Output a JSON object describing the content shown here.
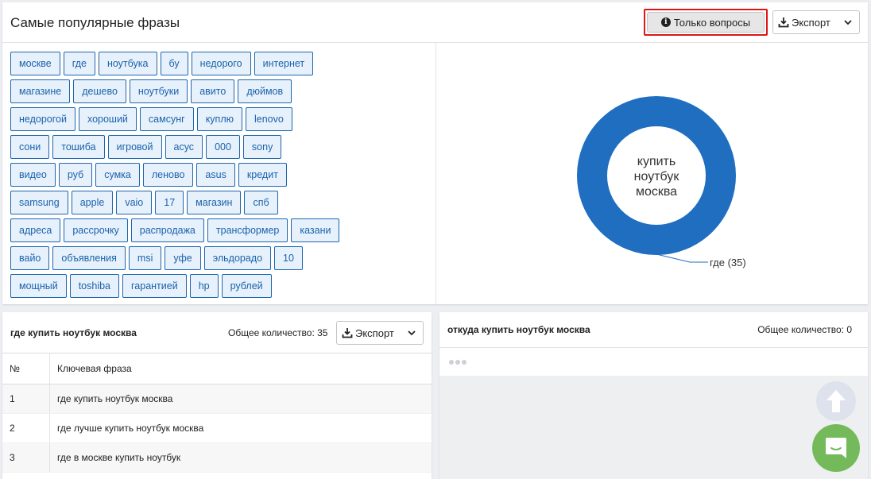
{
  "top": {
    "title": "Самые популярные фразы",
    "only_questions_label": "Только вопросы",
    "export_label": "Экспорт"
  },
  "tags": [
    [
      "москве",
      "где",
      "ноутбука",
      "бу",
      "недорого",
      "интернет"
    ],
    [
      "магазине",
      "дешево",
      "ноутбуки",
      "авито",
      "дюймов"
    ],
    [
      "недорогой",
      "хороший",
      "самсунг",
      "куплю",
      "lenovo"
    ],
    [
      "сони",
      "тошиба",
      "игровой",
      "асус",
      "000",
      "sony"
    ],
    [
      "видео",
      "руб",
      "сумка",
      "леново",
      "asus",
      "кредит"
    ],
    [
      "samsung",
      "apple",
      "vaio",
      "17",
      "магазин",
      "спб"
    ],
    [
      "адреса",
      "рассрочку",
      "распродажа",
      "трансформер",
      "казани"
    ],
    [
      "вайо",
      "объявления",
      "msi",
      "уфе",
      "эльдорадо",
      "10"
    ],
    [
      "мощный",
      "toshiba",
      "гарантией",
      "hp",
      "рублей"
    ]
  ],
  "chart_data": {
    "type": "pie",
    "center_label": [
      "купить",
      "ноутбук",
      "москва"
    ],
    "slices": [
      {
        "label": "где",
        "value": 35,
        "display": "где (35)"
      }
    ],
    "colors": [
      "#1f6ebf"
    ]
  },
  "bottom_left": {
    "title": "где купить ноутбук москва",
    "total": "Общее количество: 35",
    "export_label": "Экспорт",
    "columns": [
      "№",
      "Ключевая фраза"
    ],
    "rows": [
      {
        "num": "1",
        "phrase": "где купить ноутбук москва"
      },
      {
        "num": "2",
        "phrase": "где лучше купить ноутбук москва"
      },
      {
        "num": "3",
        "phrase": "где в москве купить ноутбук"
      }
    ]
  },
  "bottom_right": {
    "title": "откуда купить ноутбук москва",
    "total": "Общее количество: 0"
  },
  "icons": {
    "info": "info-icon",
    "download": "download-icon",
    "chevron": "chevron-down-icon",
    "scroll_up": "arrow-up-icon",
    "chat": "chat-icon"
  },
  "colors": {
    "tag_border": "#1f66ad",
    "tag_fill": "#e7f1fb",
    "donut": "#1f6ebf",
    "highlight_border": "#e01515",
    "chat": "#74b95a"
  }
}
